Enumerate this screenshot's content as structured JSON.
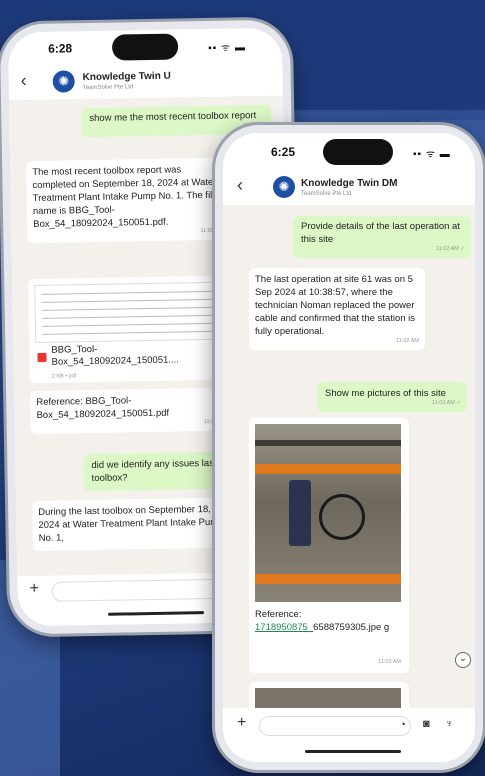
{
  "phone_back": {
    "status_time": "6:28",
    "status_icons": "▪▪ ᯤ ▬",
    "header": {
      "name": "Knowledge Twin U",
      "subtitle": "TeamSolve Pte Ltd"
    },
    "messages": {
      "m1": "show me the most recent toolbox report",
      "m1_time": "11:02 AM",
      "m2": "The most recent toolbox report was completed on September 18, 2024 at Water Treatment Plant Intake Pump No. 1. The file name is BBG_Tool-Box_54_18092024_150051.pdf.",
      "m2_time": "11:02 AM",
      "file_name": "BBG_Tool-Box_54_18092024_150051....",
      "file_meta": "2 KB • pdf",
      "ref": "Reference: BBG_Tool-Box_54_18092024_150051.pdf",
      "ref_time": "11:02 AM",
      "m3": "did we identify any issues last toolbox?",
      "m4": "During the last toolbox on September 18, 2024 at Water Treatment Plant Intake Pump No. 1,"
    }
  },
  "phone_front": {
    "status_time": "6:25",
    "status_icons": "▪▪ ᯤ ▬",
    "header": {
      "name": "Knowledge Twin DM",
      "subtitle": "TeamSolve Pte Ltd"
    },
    "messages": {
      "m1": "Provide details of the last operation at this site",
      "m1_time": "11:02 AM ✓",
      "m2": "The last operation at site 61 was on 5 Sep 2024 at 10:38:57, where the technician Noman replaced the power cable and confirmed that the station is fully operational.",
      "m2_time": "11:02 AM",
      "m3": "Show me pictures of this site",
      "m3_time": "11:03 AM ✓",
      "ref_label": "Reference:",
      "ref_link": "1718950875_",
      "ref_rest": "6588759305.jpe g",
      "ref_time": "11:03 AM"
    }
  },
  "icons": {
    "back": "‹",
    "plus": "+",
    "sticker": "◔",
    "camera": "◙",
    "mic": "♆",
    "scroll_down": "⌄",
    "avatar": "✺"
  }
}
